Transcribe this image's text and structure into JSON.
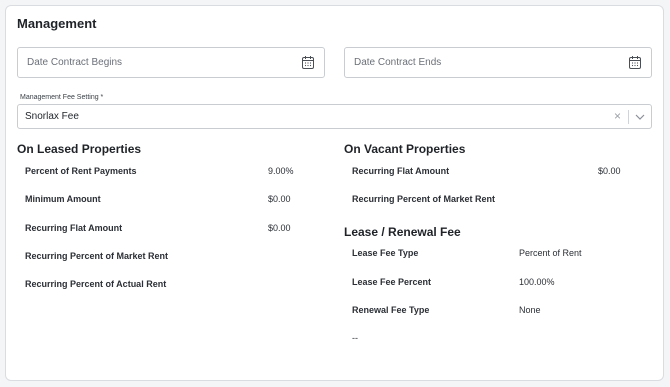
{
  "title": "Management",
  "date_begin": {
    "placeholder": "Date Contract Begins",
    "icon": "calendar-icon"
  },
  "date_end": {
    "placeholder": "Date Contract Ends",
    "icon": "calendar-icon"
  },
  "fee_setting": {
    "label": "Management Fee Setting *",
    "value": "Snorlax Fee",
    "clear_glyph": "×"
  },
  "leased": {
    "heading": "On Leased Properties",
    "rows": [
      {
        "label": "Percent of Rent Payments",
        "value": "9.00%"
      },
      {
        "label": "Minimum Amount",
        "value": "$0.00"
      },
      {
        "label": "Recurring Flat Amount",
        "value": "$0.00"
      },
      {
        "label": "Recurring Percent of Market Rent",
        "value": ""
      },
      {
        "label": "Recurring Percent of Actual Rent",
        "value": ""
      }
    ]
  },
  "vacant": {
    "heading": "On Vacant Properties",
    "rows": [
      {
        "label": "Recurring Flat Amount",
        "value": "$0.00"
      },
      {
        "label": "Recurring Percent of Market Rent",
        "value": ""
      }
    ]
  },
  "lease_renewal": {
    "heading": "Lease / Renewal Fee",
    "rows": [
      {
        "label": "Lease Fee Type",
        "value": "Percent of Rent"
      },
      {
        "label": "Lease Fee Percent",
        "value": "100.00%"
      },
      {
        "label": "Renewal Fee Type",
        "value": "None"
      }
    ],
    "footer": "--"
  }
}
